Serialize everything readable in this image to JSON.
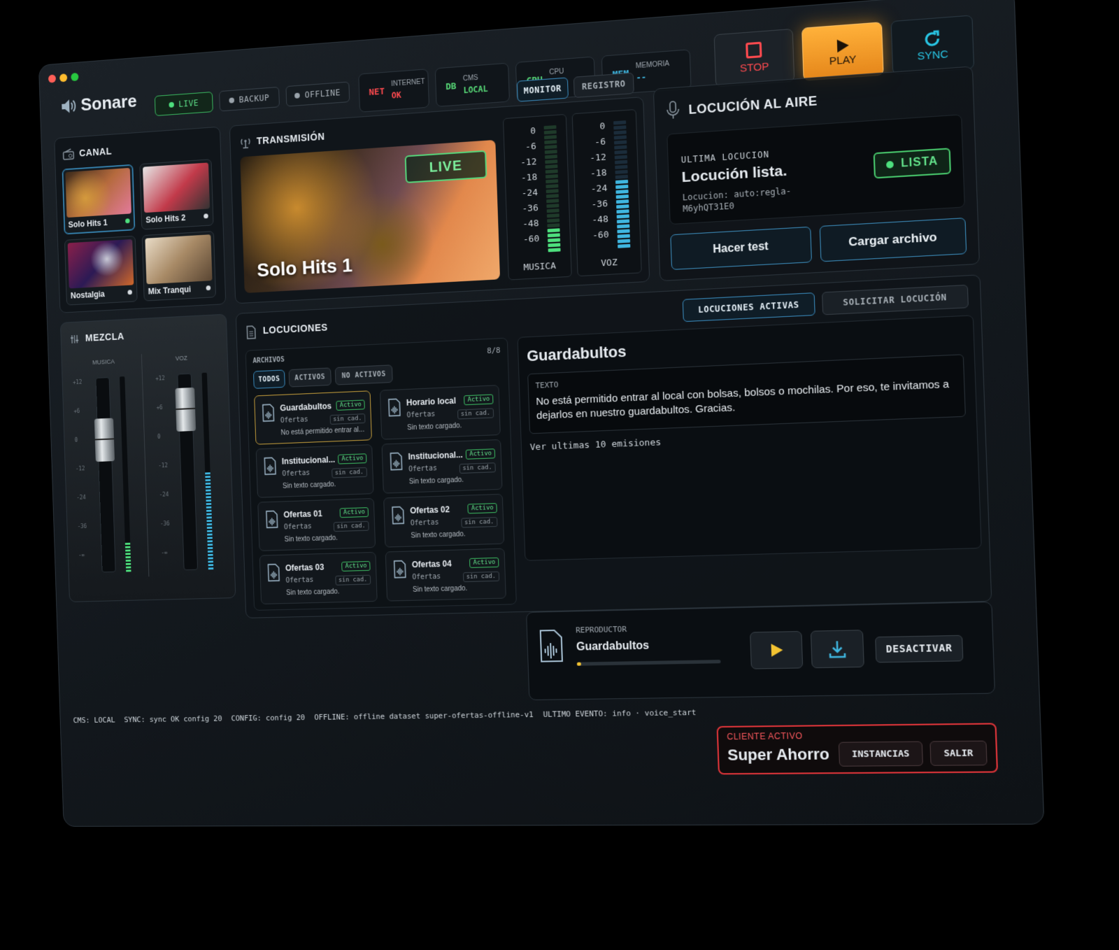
{
  "app": {
    "name": "Sonare"
  },
  "modes": [
    {
      "label": "LIVE"
    },
    {
      "label": "BACKUP"
    },
    {
      "label": "OFFLINE"
    }
  ],
  "status": {
    "net": {
      "key": "NET",
      "label": "INTERNET",
      "value": "OK"
    },
    "db": {
      "key": "DB",
      "label": "CMS",
      "value": "LOCAL"
    },
    "cpu": {
      "key": "CPU",
      "label": "CPU",
      "value": "--"
    },
    "mem": {
      "key": "MEM",
      "label": "MEMORIA",
      "value": "--"
    }
  },
  "controls": {
    "stop": "STOP",
    "play": "PLAY",
    "sync": "SYNC"
  },
  "canal": {
    "title": "CANAL",
    "channels": [
      {
        "name": "Solo Hits 1"
      },
      {
        "name": "Solo Hits 2"
      },
      {
        "name": "Nostalgia"
      },
      {
        "name": "Mix Tranqui"
      }
    ]
  },
  "transmision": {
    "title": "TRANSMISIÓN",
    "tabs": [
      "MONITOR",
      "REGISTRO"
    ],
    "badge": "LIVE",
    "now_playing": "Solo Hits 1",
    "meters": [
      {
        "label": "MUSICA",
        "scale": [
          "0",
          "-6",
          "-12",
          "-18",
          "-24",
          "-36",
          "-48",
          "-60"
        ],
        "level": 0.18
      },
      {
        "label": "VOZ",
        "scale": [
          "0",
          "-6",
          "-12",
          "-18",
          "-24",
          "-36",
          "-48",
          "-60"
        ],
        "level": 0.55
      }
    ]
  },
  "locucion_aire": {
    "title": "LOCUCIÓN AL AIRE",
    "last_label": "ULTIMA LOCUCION",
    "headline": "Locución lista.",
    "detail": "Locucion: auto:regla-M6yhQT31E0",
    "badge": "LISTA",
    "btn_test": "Hacer test",
    "btn_upload": "Cargar archivo"
  },
  "mezcla": {
    "title": "MEZCLA",
    "channels": [
      {
        "label": "MUSICA",
        "level": 0.15
      },
      {
        "label": "VOZ",
        "level": 0.5
      }
    ],
    "scale": [
      "+12",
      "+6",
      "0",
      "-12",
      "-24",
      "-36",
      "-∞"
    ]
  },
  "locuciones": {
    "title": "LOCUCIONES",
    "tabs": [
      "LOCUCIONES ACTIVAS",
      "SOLICITAR LOCUCIÓN"
    ],
    "archivos_label": "ARCHIVOS",
    "count": "8/8",
    "filters": [
      "TODOS",
      "ACTIVOS",
      "NO ACTIVOS"
    ],
    "files": [
      {
        "title": "Guardabultos",
        "cat": "Ofertas",
        "text": "No está permitido entrar al...",
        "status": "Activo",
        "cad": "sin cad."
      },
      {
        "title": "Horario local",
        "cat": "Ofertas",
        "text": "Sin texto cargado.",
        "status": "Activo",
        "cad": "sin cad."
      },
      {
        "title": "Institucional...",
        "cat": "Ofertas",
        "text": "Sin texto cargado.",
        "status": "Activo",
        "cad": "sin cad."
      },
      {
        "title": "Institucional...",
        "cat": "Ofertas",
        "text": "Sin texto cargado.",
        "status": "Activo",
        "cad": "sin cad."
      },
      {
        "title": "Ofertas 01",
        "cat": "Ofertas",
        "text": "Sin texto cargado.",
        "status": "Activo",
        "cad": "sin cad."
      },
      {
        "title": "Ofertas 02",
        "cat": "Ofertas",
        "text": "Sin texto cargado.",
        "status": "Activo",
        "cad": "sin cad."
      },
      {
        "title": "Ofertas 03",
        "cat": "Ofertas",
        "text": "Sin texto cargado.",
        "status": "Activo",
        "cad": "sin cad."
      },
      {
        "title": "Ofertas 04",
        "cat": "Ofertas",
        "text": "Sin texto cargado.",
        "status": "Activo",
        "cad": "sin cad."
      }
    ],
    "detail": {
      "title": "Guardabultos",
      "texto_label": "TEXTO",
      "texto": "No está permitido entrar al local con bolsas, bolsos o mochilas. Por eso, te invitamos a dejarlos en nuestro guardabultos. Gracias.",
      "history": "Ver ultimas 10 emisiones"
    },
    "player": {
      "label": "REPRODUCTOR",
      "track": "Guardabultos",
      "progress": 0.02,
      "deactivate": "DESACTIVAR"
    }
  },
  "statusbar": {
    "cms": "CMS: LOCAL",
    "sync": "SYNC: sync OK config 20",
    "config": "CONFIG: config 20",
    "offline": "OFFLINE: offline dataset super-ofertas-offline-v1",
    "event": "ULTIMO EVENTO: info · voice_start"
  },
  "client": {
    "label": "CLIENTE ACTIVO",
    "name": "Super Ahorro",
    "btn_instances": "INSTANCIAS",
    "btn_exit": "SALIR"
  },
  "colors": {
    "accent": "#3d8fbf",
    "live": "#4ee07e",
    "play": "#f39a1e",
    "stop": "#e0353a",
    "sync": "#29c7e6"
  }
}
